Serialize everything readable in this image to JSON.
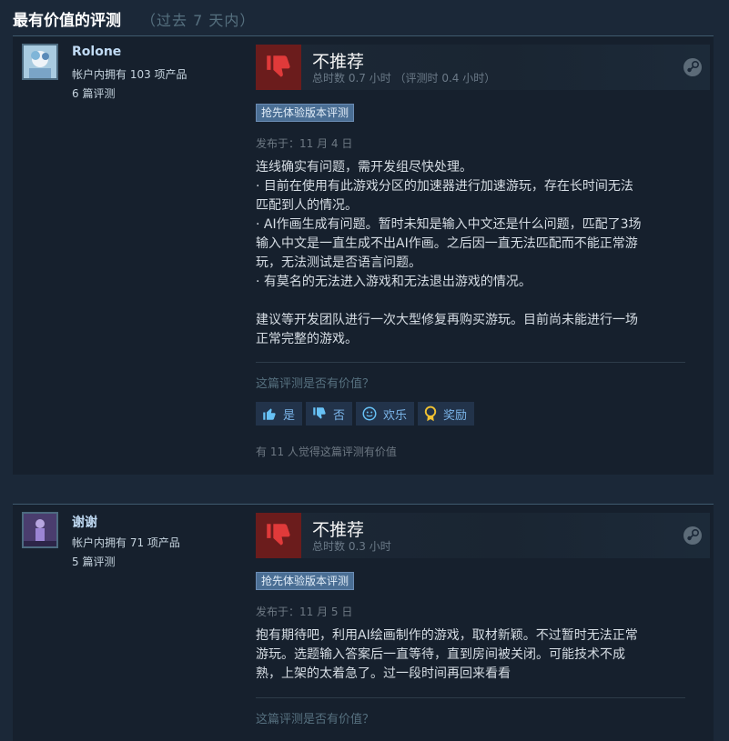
{
  "header": {
    "title": "最有价值的评测",
    "subtitle": "（过去 7 天内）"
  },
  "reviews": [
    {
      "author": "Rolone",
      "owned": "帐户内拥有 103 项产品",
      "review_count": "6 篇评测",
      "verdict": "不推荐",
      "hours": "总时数 0.7 小时 （评测时 0.4 小时）",
      "badge": "抢先体验版本评测",
      "posted": "发布于：11 月 4 日",
      "lines": [
        "连线确实有问题，需开发组尽快处理。",
        "· 目前在使用有此游戏分区的加速器进行加速游玩，存在长时间无法",
        "匹配到人的情况。",
        "· AI作画生成有问题。暂时未知是输入中文还是什么问题，匹配了3场",
        "输入中文是一直生成不出AI作画。之后因一直无法匹配而不能正常游",
        "玩，无法测试是否语言问题。",
        "· 有莫名的无法进入游戏和无法退出游戏的情况。",
        "",
        "建议等开发团队进行一次大型修复再购买游玩。目前尚未能进行一场",
        "正常完整的游戏。"
      ],
      "helpful_q": "这篇评测是否有价值？",
      "buttons": {
        "yes": "是",
        "no": "否",
        "funny": "欢乐",
        "award": "奖励"
      },
      "helpful_count": "有 11 人觉得这篇评测有价值"
    },
    {
      "author": "谢谢",
      "owned": "帐户内拥有 71 项产品",
      "review_count": "5 篇评测",
      "verdict": "不推荐",
      "hours": "总时数 0.3 小时",
      "badge": "抢先体验版本评测",
      "posted": "发布于：11 月 5 日",
      "lines": [
        "抱有期待吧，利用AI绘画制作的游戏，取材新颖。不过暂时无法正常",
        "游玩。选题输入答案后一直等待，直到房间被关闭。可能技术不成",
        "熟，上架的太着急了。过一段时间再回来看看"
      ],
      "helpful_q": "这篇评测是否有价值？"
    }
  ],
  "colors": {
    "background": "#1b2838",
    "panel": "#16202d",
    "thumb_down": "#6b1c1c",
    "badge": "#4a6e94",
    "link": "#7ab4e8"
  }
}
